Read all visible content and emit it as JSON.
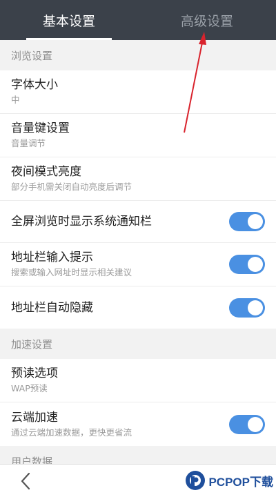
{
  "tabs": [
    {
      "label": "基本设置",
      "active": true
    },
    {
      "label": "高级设置",
      "active": false
    }
  ],
  "sections": [
    {
      "header": "浏览设置",
      "items": [
        {
          "title": "字体大小",
          "subtitle": "中",
          "toggle": null
        },
        {
          "title": "音量键设置",
          "subtitle": "音量调节",
          "toggle": null
        },
        {
          "title": "夜间模式亮度",
          "subtitle": "部分手机需关闭自动亮度后调节",
          "toggle": null
        },
        {
          "title": "全屏浏览时显示系统通知栏",
          "subtitle": "",
          "toggle": true
        },
        {
          "title": "地址栏输入提示",
          "subtitle": "搜索或输入网址时显示相关建议",
          "toggle": true
        },
        {
          "title": "地址栏自动隐藏",
          "subtitle": "",
          "toggle": true
        }
      ]
    },
    {
      "header": "加速设置",
      "items": [
        {
          "title": "预读选项",
          "subtitle": "WAP预读",
          "toggle": null
        },
        {
          "title": "云端加速",
          "subtitle": "通过云端加速数据，更快更省流",
          "toggle": true
        }
      ]
    },
    {
      "header": "用户数据",
      "items": []
    }
  ],
  "bottom": {
    "back_icon": "chevron-left-icon"
  },
  "watermark": {
    "text": "PCPOP下载"
  },
  "colors": {
    "tabbar": "#3b414a",
    "toggle_on": "#4a90e2",
    "annotation_arrow": "#d9232d"
  }
}
